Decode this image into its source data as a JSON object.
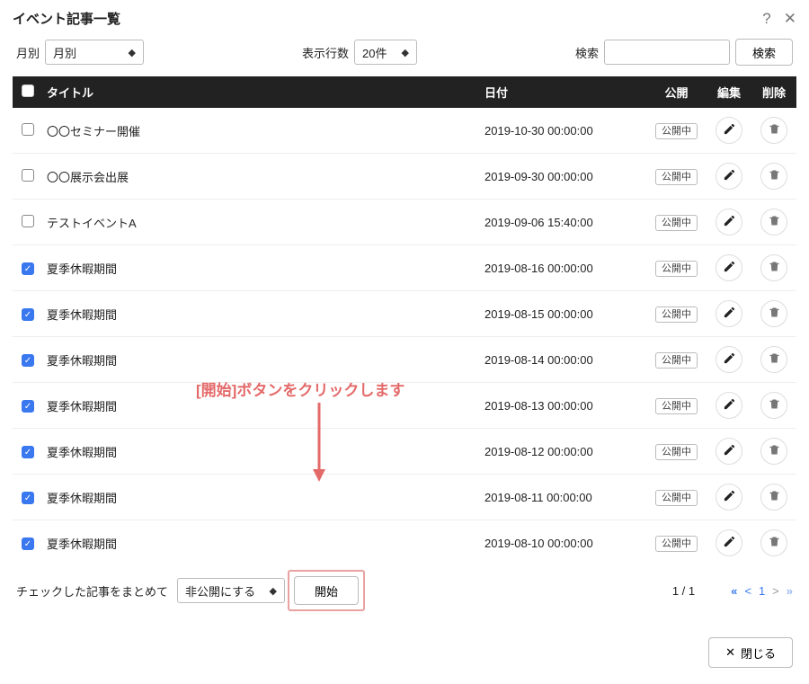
{
  "dialog": {
    "title": "イベント記事一覧"
  },
  "filters": {
    "month_label": "月別",
    "month_value": "月別",
    "rows_label": "表示行数",
    "rows_value": "20件",
    "search_label": "検索",
    "search_value": "",
    "search_button": "検索"
  },
  "columns": {
    "title": "タイトル",
    "date": "日付",
    "publish": "公開",
    "edit": "編集",
    "delete": "削除"
  },
  "rows": [
    {
      "checked": false,
      "title": "〇〇セミナー開催",
      "date": "2019-10-30 00:00:00",
      "status": "公開中"
    },
    {
      "checked": false,
      "title": "〇〇展示会出展",
      "date": "2019-09-30 00:00:00",
      "status": "公開中"
    },
    {
      "checked": false,
      "title": "テストイベントA",
      "date": "2019-09-06 15:40:00",
      "status": "公開中"
    },
    {
      "checked": true,
      "title": "夏季休暇期間",
      "date": "2019-08-16 00:00:00",
      "status": "公開中"
    },
    {
      "checked": true,
      "title": "夏季休暇期間",
      "date": "2019-08-15 00:00:00",
      "status": "公開中"
    },
    {
      "checked": true,
      "title": "夏季休暇期間",
      "date": "2019-08-14 00:00:00",
      "status": "公開中"
    },
    {
      "checked": true,
      "title": "夏季休暇期間",
      "date": "2019-08-13 00:00:00",
      "status": "公開中"
    },
    {
      "checked": true,
      "title": "夏季休暇期間",
      "date": "2019-08-12 00:00:00",
      "status": "公開中"
    },
    {
      "checked": true,
      "title": "夏季休暇期間",
      "date": "2019-08-11 00:00:00",
      "status": "公開中"
    },
    {
      "checked": true,
      "title": "夏季休暇期間",
      "date": "2019-08-10 00:00:00",
      "status": "公開中"
    }
  ],
  "bulk": {
    "label": "チェックした記事をまとめて",
    "action_value": "非公開にする",
    "start_button": "開始"
  },
  "pager": {
    "position": "1 / 1",
    "first": "«",
    "prev": "<",
    "current": "1",
    "next": ">",
    "last": "»"
  },
  "callout_text": "[開始]ボタンをクリックします",
  "close_button": "閉じる"
}
